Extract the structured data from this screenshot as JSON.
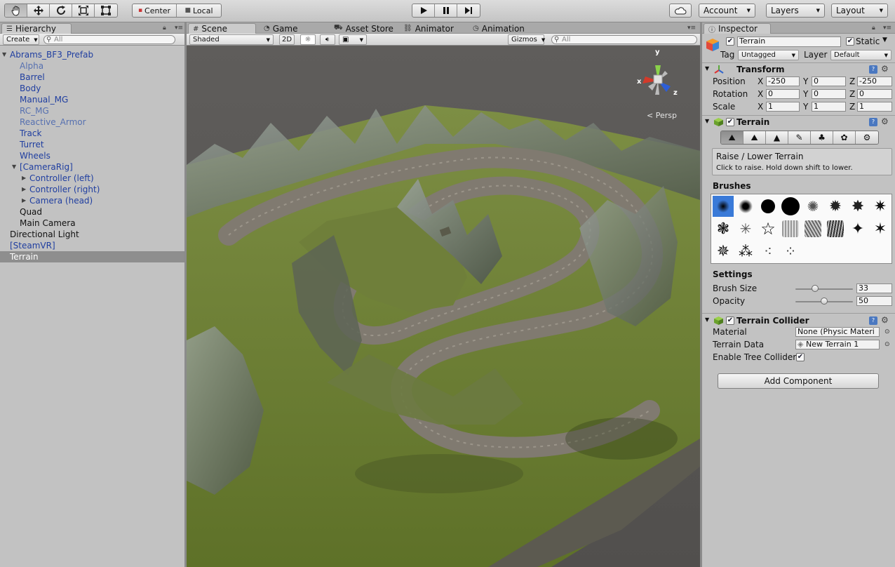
{
  "toolbar": {
    "pivot_label": "Center",
    "space_label": "Local",
    "account_label": "Account",
    "layers_label": "Layers",
    "layout_label": "Layout"
  },
  "hierarchy": {
    "tab_label": "Hierarchy",
    "create_label": "Create",
    "search_placeholder": "All",
    "items": [
      {
        "label": "Abrams_BF3_Prefab"
      },
      {
        "label": "Alpha"
      },
      {
        "label": "Barrel"
      },
      {
        "label": "Body"
      },
      {
        "label": "Manual_MG"
      },
      {
        "label": "RC_MG"
      },
      {
        "label": "Reactive_Armor"
      },
      {
        "label": "Track"
      },
      {
        "label": "Turret"
      },
      {
        "label": "Wheels"
      },
      {
        "label": "[CameraRig]"
      },
      {
        "label": "Controller (left)"
      },
      {
        "label": "Controller (right)"
      },
      {
        "label": "Camera (head)"
      },
      {
        "label": "Quad"
      },
      {
        "label": "Main Camera"
      },
      {
        "label": "Directional Light"
      },
      {
        "label": "[SteamVR]"
      },
      {
        "label": "Terrain"
      }
    ]
  },
  "scene": {
    "tabs": [
      {
        "label": "Scene"
      },
      {
        "label": "Game"
      },
      {
        "label": "Asset Store"
      },
      {
        "label": "Animator"
      },
      {
        "label": "Animation"
      }
    ],
    "shading_mode": "Shaded",
    "mode_2d": "2D",
    "gizmos_label": "Gizmos",
    "search_placeholder": "All",
    "axis_y": "y",
    "axis_x": "x",
    "axis_z": "z",
    "projection_label": "Persp"
  },
  "inspector": {
    "tab_label": "Inspector",
    "object_name": "Terrain",
    "static_label": "Static",
    "tag_label": "Tag",
    "tag_value": "Untagged",
    "layer_label": "Layer",
    "layer_value": "Default",
    "transform": {
      "title": "Transform",
      "position_label": "Position",
      "rotation_label": "Rotation",
      "scale_label": "Scale",
      "x": "X",
      "y": "Y",
      "z": "Z",
      "position": [
        "-250",
        "0",
        "-250"
      ],
      "rotation": [
        "0",
        "0",
        "0"
      ],
      "scale": [
        "1",
        "1",
        "1"
      ]
    },
    "terrain": {
      "title": "Terrain",
      "tool_title": "Raise / Lower Terrain",
      "tool_help": "Click to raise. Hold down shift to lower.",
      "brushes_label": "Brushes",
      "settings_label": "Settings",
      "brush_size_label": "Brush Size",
      "brush_size_value": "33",
      "opacity_label": "Opacity",
      "opacity_value": "50"
    },
    "collider": {
      "title": "Terrain Collider",
      "material_label": "Material",
      "material_value": "None (Physic Materi",
      "terrain_data_label": "Terrain Data",
      "terrain_data_value": "New Terrain 1",
      "tree_collider_label": "Enable Tree Collider"
    },
    "add_component_label": "Add Component"
  }
}
